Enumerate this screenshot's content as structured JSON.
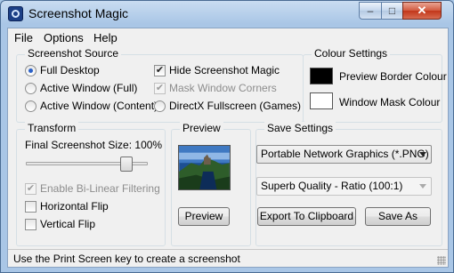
{
  "window": {
    "title": "Screenshot Magic",
    "controls": {
      "minimize": "–",
      "maximize": "□",
      "close": "✕"
    }
  },
  "menu": {
    "items": [
      "File",
      "Options",
      "Help"
    ]
  },
  "screenshot_source": {
    "title": "Screenshot Source",
    "radios": [
      {
        "label": "Full Desktop",
        "selected": true
      },
      {
        "label": "Active Window (Full)",
        "selected": false
      },
      {
        "label": "Active Window (Content)",
        "selected": false
      }
    ],
    "checks": [
      {
        "label": "Hide Screenshot Magic",
        "checked": true,
        "enabled": true
      },
      {
        "label": "Mask Window Corners",
        "checked": true,
        "enabled": false
      }
    ],
    "directx_radio": {
      "label": "DirectX Fullscreen (Games)",
      "selected": false
    }
  },
  "colour_settings": {
    "title": "Colour Settings",
    "preview_border": {
      "label": "Preview Border Colour",
      "color": "#000000"
    },
    "window_mask": {
      "label": "Window Mask Colour",
      "color": "#ffffff"
    }
  },
  "transform": {
    "title": "Transform",
    "size_label": "Final Screenshot Size: 100%",
    "slider_value": 100,
    "checks": [
      {
        "label": "Enable Bi-Linear Filtering",
        "checked": true,
        "enabled": false
      },
      {
        "label": "Horizontal Flip",
        "checked": false,
        "enabled": true
      },
      {
        "label": "Vertical Flip",
        "checked": false,
        "enabled": true
      }
    ]
  },
  "preview": {
    "title": "Preview",
    "button": "Preview"
  },
  "save_settings": {
    "title": "Save Settings",
    "format": "Portable Network Graphics (*.PNG)",
    "quality": "Superb Quality - Ratio (100:1)",
    "export_button": "Export To Clipboard",
    "save_button": "Save As"
  },
  "status": {
    "text": "Use the Print Screen key to create a screenshot"
  },
  "icons": {
    "check": "✔"
  }
}
